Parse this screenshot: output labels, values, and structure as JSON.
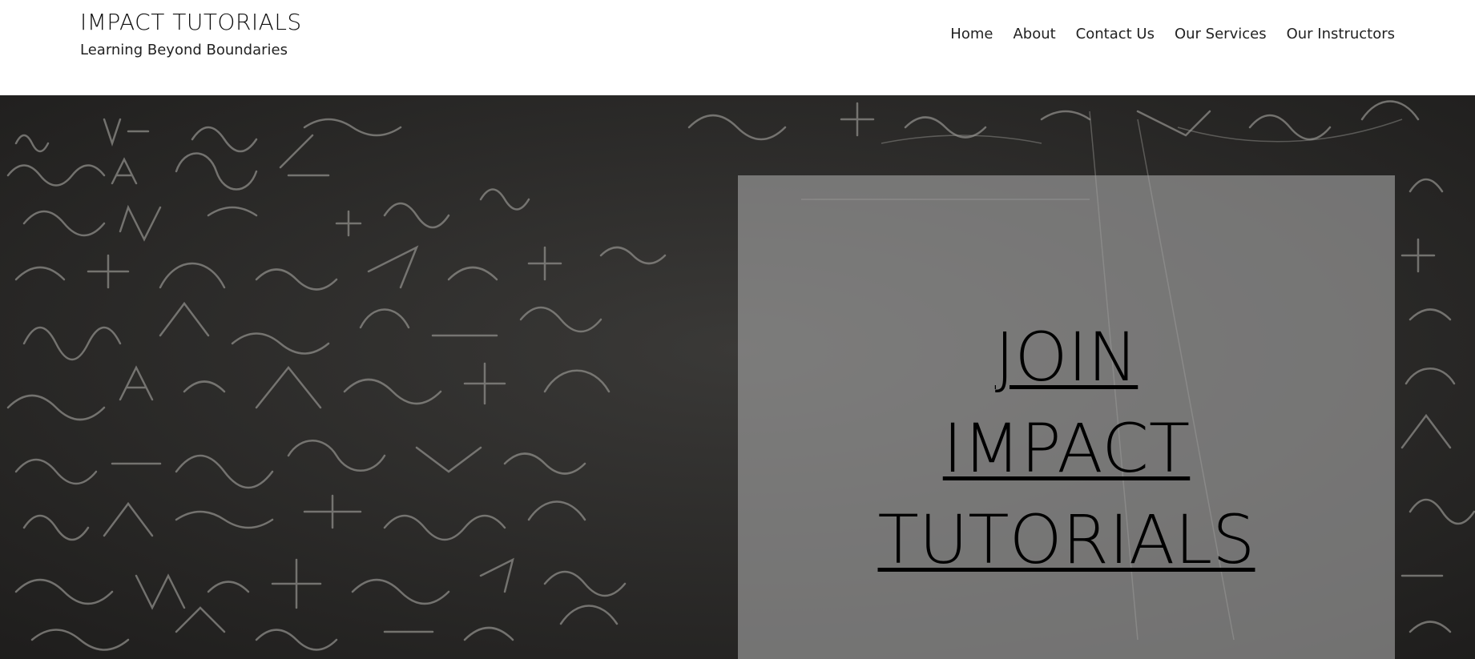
{
  "header": {
    "brand_title": "IMPACT TUTORIALS",
    "brand_tagline": "Learning Beyond Boundaries"
  },
  "nav": {
    "items": [
      {
        "label": "Home"
      },
      {
        "label": "About"
      },
      {
        "label": "Contact Us"
      },
      {
        "label": "Our Services"
      },
      {
        "label": "Our Instructors"
      }
    ]
  },
  "hero": {
    "heading_lines": [
      "JOIN",
      "IMPACT",
      "TUTORIALS"
    ],
    "background_description": "chalkboard with handwritten math equations",
    "panel_color": "#a5a5a5"
  }
}
